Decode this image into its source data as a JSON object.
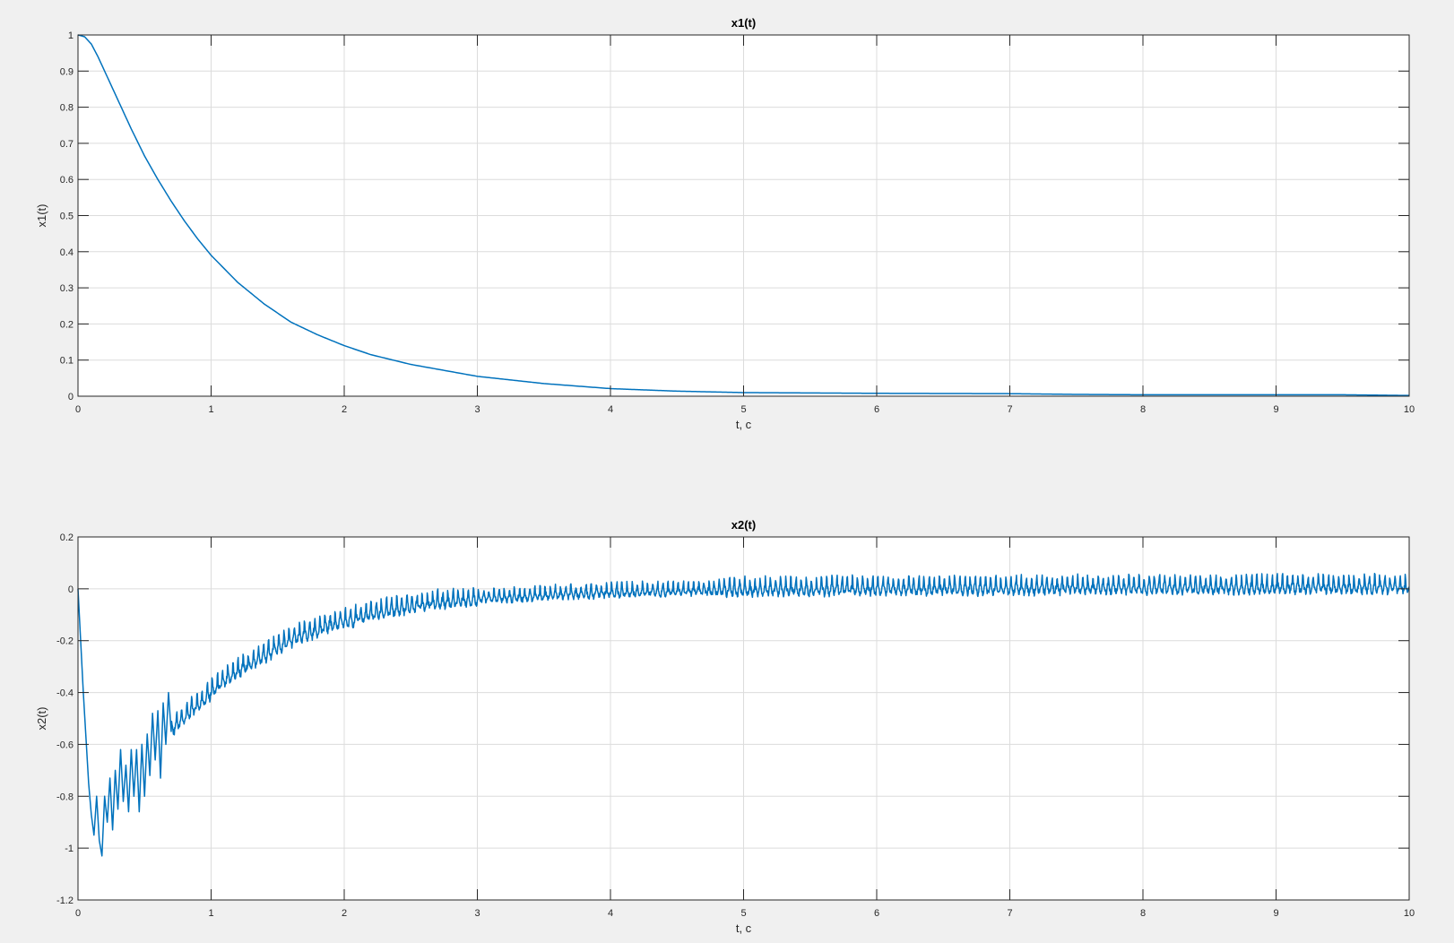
{
  "colors": {
    "background": "#f0f0f0",
    "axes_background": "#ffffff",
    "series": "#0072bd",
    "grid": "#dcdcdc",
    "axis": "#262626"
  },
  "chart_data": [
    {
      "type": "line",
      "title": "x1(t)",
      "xlabel": "t, c",
      "ylabel": "x1(t)",
      "xlim": [
        0,
        10
      ],
      "ylim": [
        0,
        1
      ],
      "grid": true,
      "xticks": [
        0,
        1,
        2,
        3,
        4,
        5,
        6,
        7,
        8,
        9,
        10
      ],
      "xtick_labels": [
        "0",
        "1",
        "2",
        "3",
        "4",
        "5",
        "6",
        "7",
        "8",
        "9",
        "10"
      ],
      "yticks": [
        0,
        0.1,
        0.2,
        0.3,
        0.4,
        0.5,
        0.6,
        0.7,
        0.8,
        0.9,
        1
      ],
      "ytick_labels": [
        "0",
        "0.1",
        "0.2",
        "0.3",
        "0.4",
        "0.5",
        "0.6",
        "0.7",
        "0.8",
        "0.9",
        "1"
      ],
      "series": [
        {
          "x": [
            0,
            0.05,
            0.1,
            0.15,
            0.2,
            0.3,
            0.4,
            0.5,
            0.6,
            0.7,
            0.8,
            0.9,
            1.0,
            1.2,
            1.4,
            1.6,
            1.8,
            2.0,
            2.2,
            2.5,
            3.0,
            3.5,
            4.0,
            4.5,
            5.0,
            6.0,
            7.0,
            7.5,
            8.0,
            9.0,
            9.5,
            10.0
          ],
          "y": [
            1.0,
            0.995,
            0.975,
            0.94,
            0.9,
            0.82,
            0.74,
            0.665,
            0.6,
            0.54,
            0.485,
            0.435,
            0.39,
            0.315,
            0.255,
            0.205,
            0.17,
            0.14,
            0.115,
            0.088,
            0.055,
            0.035,
            0.021,
            0.014,
            0.01,
            0.008,
            0.007,
            0.005,
            0.004,
            0.004,
            0.004,
            0.002
          ]
        }
      ]
    },
    {
      "type": "line",
      "title": "x2(t)",
      "xlabel": "t, c",
      "ylabel": "x2(t)",
      "xlim": [
        0,
        10
      ],
      "ylim": [
        -1.2,
        0.2
      ],
      "grid": true,
      "xticks": [
        0,
        1,
        2,
        3,
        4,
        5,
        6,
        7,
        8,
        9,
        10
      ],
      "xtick_labels": [
        "0",
        "1",
        "2",
        "3",
        "4",
        "5",
        "6",
        "7",
        "8",
        "9",
        "10"
      ],
      "yticks": [
        -1.2,
        -1,
        -0.8,
        -0.6,
        -0.4,
        -0.2,
        0,
        0.2
      ],
      "ytick_labels": [
        "-1.2",
        "-1",
        "-0.8",
        "-0.6",
        "-0.4",
        "-0.2",
        "0",
        "0.2"
      ],
      "series": [
        {
          "x": [
            0,
            0.04,
            0.08,
            0.1,
            0.12,
            0.14,
            0.16,
            0.18,
            0.2,
            0.22,
            0.24,
            0.26,
            0.28,
            0.3,
            0.32,
            0.34,
            0.36,
            0.38,
            0.4,
            0.42,
            0.44,
            0.46,
            0.48,
            0.5,
            0.52,
            0.54,
            0.56,
            0.58,
            0.6,
            0.62,
            0.64,
            0.66,
            0.68,
            0.7,
            0.75,
            0.8,
            0.85,
            0.9,
            0.95,
            1.0,
            1.1,
            1.2,
            1.3,
            1.4,
            1.5,
            1.6,
            1.7,
            1.8,
            1.9,
            2.0,
            2.2,
            2.4,
            2.6,
            2.8,
            3.0,
            3.2,
            3.4,
            3.6,
            3.8,
            4.0,
            4.5,
            5.0,
            5.5,
            6.0,
            6.5,
            7.0,
            7.5,
            8.0,
            8.5,
            9.0,
            9.5,
            10.0
          ],
          "y": [
            0.0,
            -0.4,
            -0.75,
            -0.87,
            -0.95,
            -0.8,
            -0.97,
            -1.03,
            -0.8,
            -0.9,
            -0.73,
            -0.93,
            -0.7,
            -0.85,
            -0.62,
            -0.82,
            -0.68,
            -0.86,
            -0.62,
            -0.8,
            -0.62,
            -0.86,
            -0.6,
            -0.8,
            -0.56,
            -0.72,
            -0.48,
            -0.66,
            -0.47,
            -0.73,
            -0.44,
            -0.6,
            -0.4,
            -0.55,
            -0.52,
            -0.5,
            -0.47,
            -0.45,
            -0.43,
            -0.4,
            -0.36,
            -0.32,
            -0.29,
            -0.26,
            -0.23,
            -0.2,
            -0.18,
            -0.16,
            -0.14,
            -0.13,
            -0.1,
            -0.08,
            -0.06,
            -0.05,
            -0.04,
            -0.035,
            -0.03,
            -0.025,
            -0.02,
            -0.015,
            -0.01,
            -0.005,
            -0.003,
            0.0,
            0.0,
            0.0,
            0.003,
            0.003,
            0.003,
            0.005,
            0.005,
            0.005
          ]
        }
      ]
    }
  ]
}
